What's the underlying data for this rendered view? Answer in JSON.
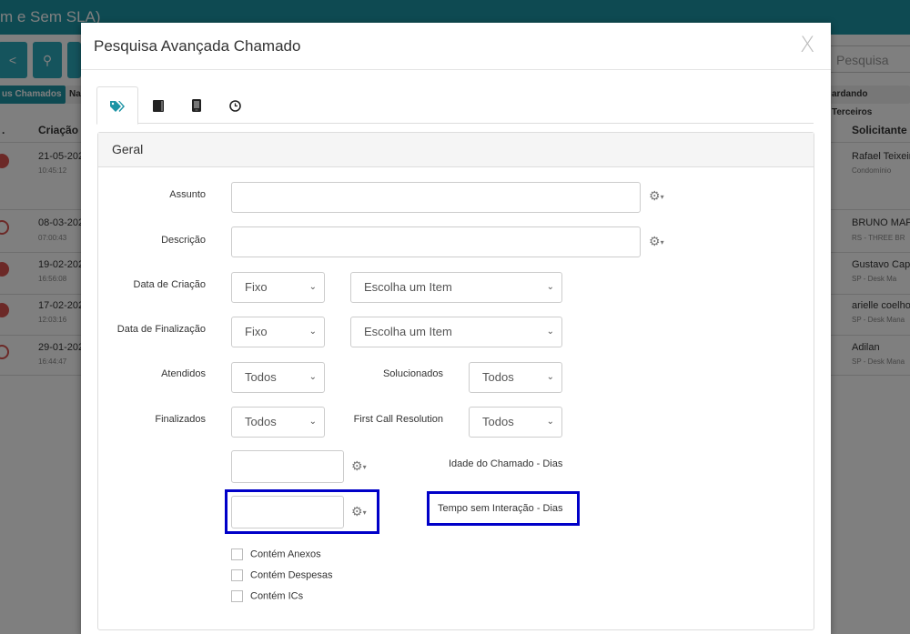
{
  "background": {
    "title": "m e Sem SLA)",
    "search_placeholder": "Pesquisa",
    "tabs": [
      "us Chamados",
      "Na",
      "ardando Terceiros"
    ],
    "columns": {
      "c0": ".",
      "creation": "Criação",
      "requester": "Solicitante"
    },
    "rows": [
      {
        "date": "21-05-202",
        "time": "10:45:12",
        "requester": "Rafael Teixeir",
        "sub": "Condomínio"
      },
      {
        "date": "08-03-202",
        "time": "07:00:43",
        "requester": "BRUNO MAF",
        "sub": "RS - THREE BR"
      },
      {
        "date": "19-02-202",
        "time": "16:56:08",
        "requester": "Gustavo Cap",
        "sub": "SP - Desk Ma"
      },
      {
        "date": "17-02-202",
        "time": "12:03:16",
        "requester": "arielle coelho",
        "sub": "SP - Desk Mana"
      },
      {
        "date": "29-01-202",
        "time": "16:44:47",
        "requester": "Adilan",
        "sub": "SP - Desk Mana"
      }
    ]
  },
  "modal": {
    "title": "Pesquisa Avançada Chamado",
    "close": "X",
    "tabs": [
      {
        "icon": "tags-icon"
      },
      {
        "icon": "book-icon"
      },
      {
        "icon": "mobile-icon"
      },
      {
        "icon": "clock-icon"
      }
    ],
    "panel_title": "Geral",
    "fields": {
      "assunto": {
        "label": "Assunto",
        "value": ""
      },
      "descricao": {
        "label": "Descrição",
        "value": ""
      },
      "data_criacao": {
        "label": "Data de Criação",
        "mode": "Fixo",
        "item": "Escolha um Item"
      },
      "data_finalizacao": {
        "label": "Data de Finalização",
        "mode": "Fixo",
        "item": "Escolha um Item"
      },
      "atendidos": {
        "label": "Atendidos",
        "value": "Todos"
      },
      "solucionados": {
        "label": "Solucionados",
        "value": "Todos"
      },
      "finalizados": {
        "label": "Finalizados",
        "value": "Todos"
      },
      "fcr": {
        "label": "First Call Resolution",
        "value": "Todos"
      },
      "idade": {
        "label": "Idade do Chamado - Dias",
        "value": ""
      },
      "tempo": {
        "label": "Tempo sem Interação - Dias",
        "value": ""
      }
    },
    "checkboxes": [
      {
        "label": "Contém Anexos",
        "checked": false
      },
      {
        "label": "Contém Despesas",
        "checked": false
      },
      {
        "label": "Contém ICs",
        "checked": false
      }
    ],
    "gear_icon": "⚙",
    "caret_icon": "▾",
    "chevron_icon": "⌄"
  },
  "colors": {
    "highlight": "#0000c8",
    "accent": "#1d94a5",
    "status": "#d9534f"
  }
}
